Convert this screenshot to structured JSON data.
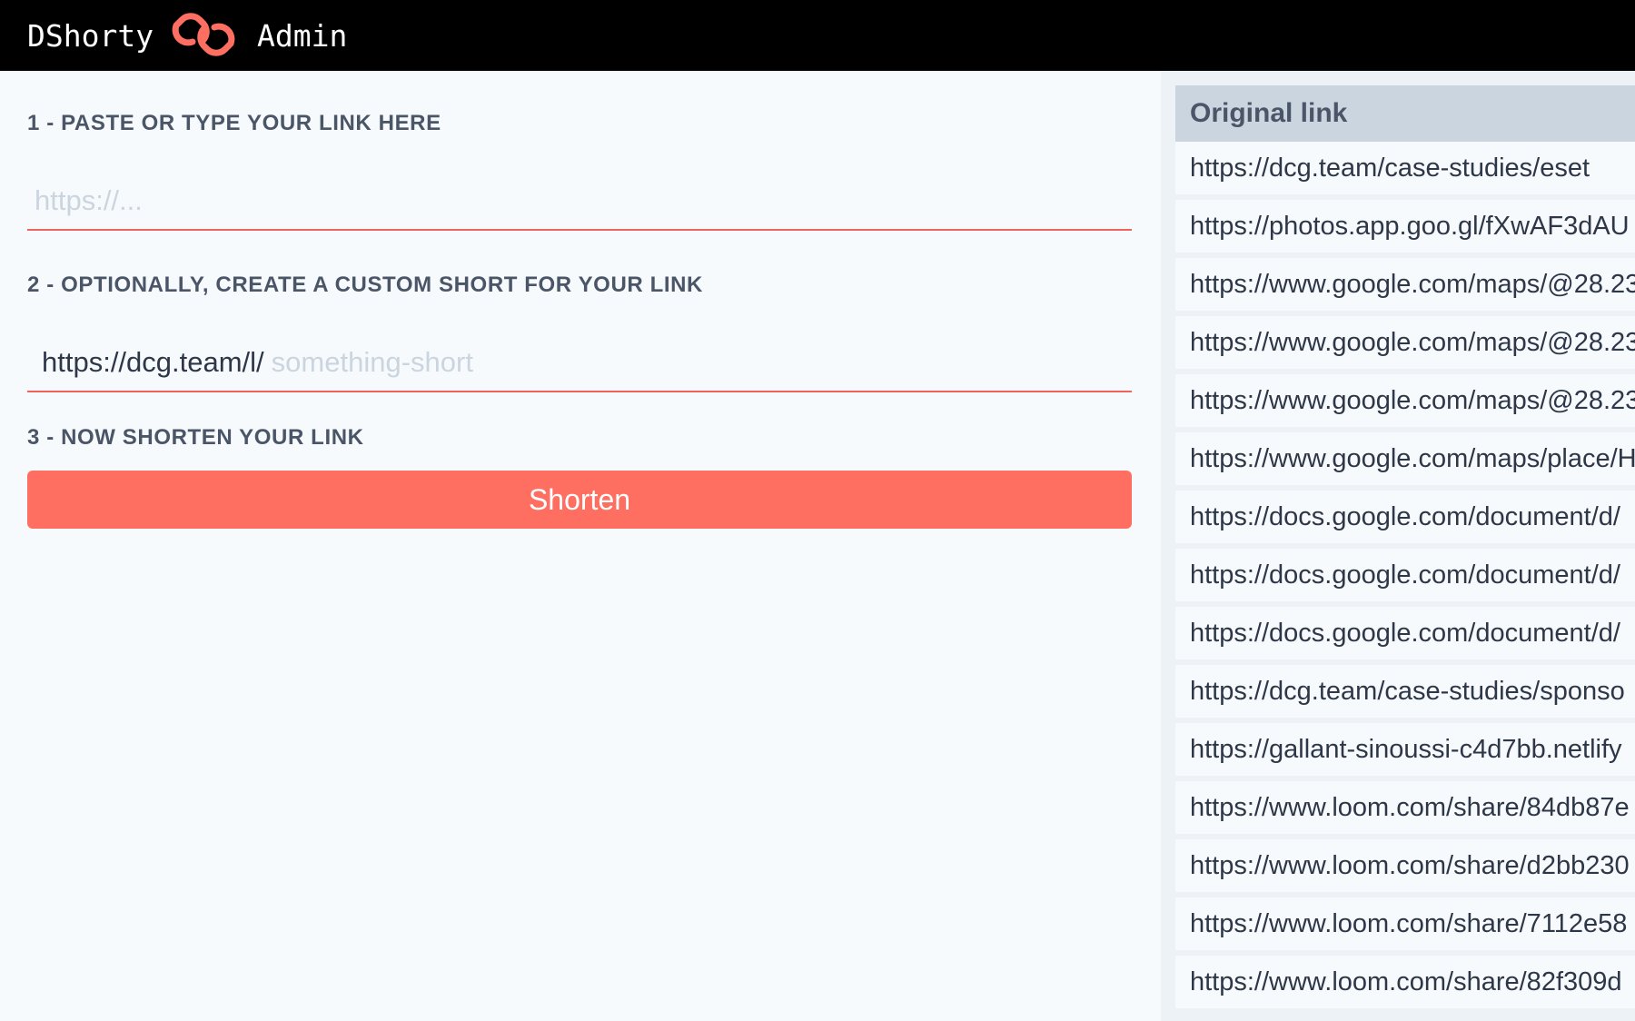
{
  "header": {
    "brand": "DShorty",
    "logo_icon": "chain-link-icon",
    "section": "Admin",
    "accent_color": "#ff6f61"
  },
  "form": {
    "step1_label": "1 - PASTE OR TYPE YOUR LINK HERE",
    "url_placeholder": "https://...",
    "step2_label": "2 - OPTIONALLY, CREATE A CUSTOM SHORT FOR YOUR LINK",
    "short_prefix": "https://dcg.team/l/",
    "short_placeholder": "something-short",
    "step3_label": "3 - NOW SHORTEN YOUR LINK",
    "shorten_label": "Shorten"
  },
  "links_table": {
    "header": "Original link",
    "rows": [
      "https://dcg.team/case-studies/eset",
      "https://photos.app.goo.gl/fXwAF3dAU",
      "https://www.google.com/maps/@28.23",
      "https://www.google.com/maps/@28.23",
      "https://www.google.com/maps/@28.23",
      "https://www.google.com/maps/place/H",
      "https://docs.google.com/document/d/",
      "https://docs.google.com/document/d/",
      "https://docs.google.com/document/d/",
      "https://dcg.team/case-studies/sponso",
      "https://gallant-sinoussi-c4d7bb.netlify",
      "https://www.loom.com/share/84db87e",
      "https://www.loom.com/share/d2bb230",
      "https://www.loom.com/share/7112e58",
      "https://www.loom.com/share/82f309d"
    ]
  }
}
